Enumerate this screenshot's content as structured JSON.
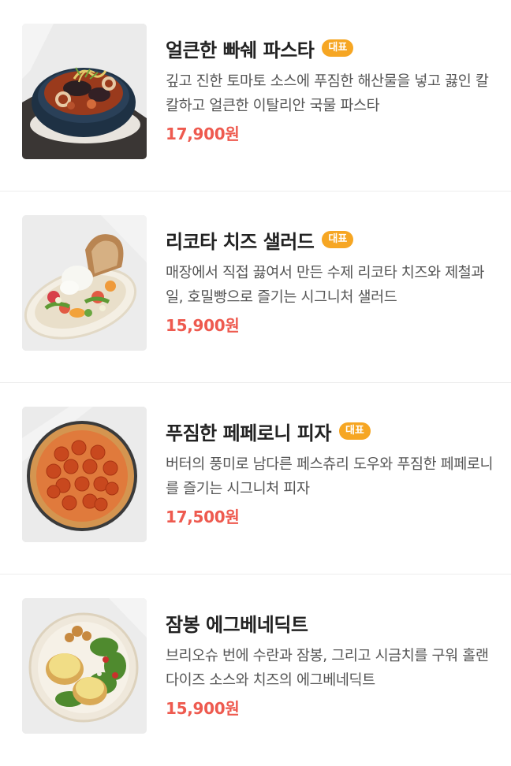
{
  "menu": {
    "items": [
      {
        "name": "얼큰한 빠쉐 파스타",
        "badge": "대표",
        "description": "깊고 진한 토마토 소스에 푸짐한 해산물을 넣고 끓인 칼칼하고 얼큰한 이탈리안 국물 파스타",
        "price": "17,900원",
        "image": "seafood-soup-pasta"
      },
      {
        "name": "리코타 치즈 샐러드",
        "badge": "대표",
        "description": "매장에서 직접 끓여서 만든 수제 리코타 치즈와 제철과일, 호밀빵으로 즐기는 시그니처 샐러드",
        "price": "15,900원",
        "image": "ricotta-salad"
      },
      {
        "name": "푸짐한 페페로니 피자",
        "badge": "대표",
        "description": "버터의 풍미로 남다른 페스츄리 도우와 푸짐한 페페로니를 즐기는 시그니처 피자",
        "price": "17,500원",
        "image": "pepperoni-pizza"
      },
      {
        "name": "잠봉 에그베네딕트",
        "badge": "",
        "description": "브리오슈 번에 수란과 잠봉, 그리고 시금치를 구워 홀랜다이즈 소스와 치즈의 에그베네딕트",
        "price": "15,900원",
        "image": "eggs-benedict"
      }
    ]
  },
  "colors": {
    "badge": "#f6a623",
    "price": "#ee5a4f",
    "title": "#222222",
    "description": "#555555"
  }
}
